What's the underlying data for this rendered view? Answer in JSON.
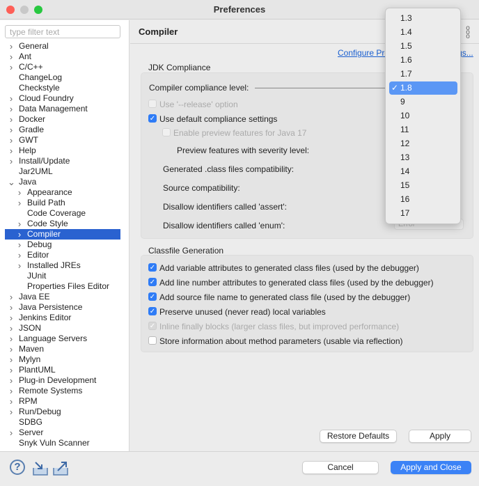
{
  "window": {
    "title": "Preferences"
  },
  "filter": {
    "placeholder": "type filter text"
  },
  "tree": [
    {
      "label": "General",
      "exp": "collapsed",
      "lvl": 0
    },
    {
      "label": "Ant",
      "exp": "collapsed",
      "lvl": 0
    },
    {
      "label": "C/C++",
      "exp": "collapsed",
      "lvl": 0
    },
    {
      "label": "ChangeLog",
      "exp": "none",
      "lvl": 0
    },
    {
      "label": "Checkstyle",
      "exp": "none",
      "lvl": 0
    },
    {
      "label": "Cloud Foundry",
      "exp": "collapsed",
      "lvl": 0
    },
    {
      "label": "Data Management",
      "exp": "collapsed",
      "lvl": 0
    },
    {
      "label": "Docker",
      "exp": "collapsed",
      "lvl": 0
    },
    {
      "label": "Gradle",
      "exp": "collapsed",
      "lvl": 0
    },
    {
      "label": "GWT",
      "exp": "collapsed",
      "lvl": 0
    },
    {
      "label": "Help",
      "exp": "collapsed",
      "lvl": 0
    },
    {
      "label": "Install/Update",
      "exp": "collapsed",
      "lvl": 0
    },
    {
      "label": "Jar2UML",
      "exp": "none",
      "lvl": 0
    },
    {
      "label": "Java",
      "exp": "expanded",
      "lvl": 0
    },
    {
      "label": "Appearance",
      "exp": "collapsed",
      "lvl": 1
    },
    {
      "label": "Build Path",
      "exp": "collapsed",
      "lvl": 1
    },
    {
      "label": "Code Coverage",
      "exp": "none",
      "lvl": 1
    },
    {
      "label": "Code Style",
      "exp": "collapsed",
      "lvl": 1
    },
    {
      "label": "Compiler",
      "exp": "collapsed",
      "lvl": 1,
      "selected": true
    },
    {
      "label": "Debug",
      "exp": "collapsed",
      "lvl": 1
    },
    {
      "label": "Editor",
      "exp": "collapsed",
      "lvl": 1
    },
    {
      "label": "Installed JREs",
      "exp": "collapsed",
      "lvl": 1
    },
    {
      "label": "JUnit",
      "exp": "none",
      "lvl": 1
    },
    {
      "label": "Properties Files Editor",
      "exp": "none",
      "lvl": 1
    },
    {
      "label": "Java EE",
      "exp": "collapsed",
      "lvl": 0
    },
    {
      "label": "Java Persistence",
      "exp": "collapsed",
      "lvl": 0
    },
    {
      "label": "Jenkins Editor",
      "exp": "collapsed",
      "lvl": 0
    },
    {
      "label": "JSON",
      "exp": "collapsed",
      "lvl": 0
    },
    {
      "label": "Language Servers",
      "exp": "collapsed",
      "lvl": 0
    },
    {
      "label": "Maven",
      "exp": "collapsed",
      "lvl": 0
    },
    {
      "label": "Mylyn",
      "exp": "collapsed",
      "lvl": 0
    },
    {
      "label": "PlantUML",
      "exp": "collapsed",
      "lvl": 0
    },
    {
      "label": "Plug-in Development",
      "exp": "collapsed",
      "lvl": 0
    },
    {
      "label": "Remote Systems",
      "exp": "collapsed",
      "lvl": 0
    },
    {
      "label": "RPM",
      "exp": "collapsed",
      "lvl": 0
    },
    {
      "label": "Run/Debug",
      "exp": "collapsed",
      "lvl": 0
    },
    {
      "label": "SDBG",
      "exp": "none",
      "lvl": 0
    },
    {
      "label": "Server",
      "exp": "collapsed",
      "lvl": 0
    },
    {
      "label": "Snyk Vuln Scanner",
      "exp": "none",
      "lvl": 0
    }
  ],
  "page": {
    "title": "Compiler",
    "configure_link": "Configure Project Specific Settings...",
    "jdk": {
      "label": "JDK Compliance",
      "compliance_level": "Compiler compliance level:",
      "use_release": {
        "label": "Use '--release' option",
        "checked": false,
        "disabled": true
      },
      "use_default": {
        "label": "Use default compliance settings",
        "checked": true
      },
      "enable_preview": {
        "label": "Enable preview features for Java 17",
        "checked": false,
        "disabled": true
      },
      "severity": "Preview features with severity level:",
      "generated": "Generated .class files compatibility:",
      "source": "Source compatibility:",
      "assert": "Disallow identifiers called 'assert':",
      "enum": "Disallow identifiers called 'enum':",
      "enum_value": "Error"
    },
    "classfile": {
      "label": "Classfile Generation",
      "options": [
        {
          "label": "Add variable attributes to generated class files (used by the debugger)",
          "checked": true
        },
        {
          "label": "Add line number attributes to generated class files (used by the debugger)",
          "checked": true
        },
        {
          "label": "Add source file name to generated class file (used by the debugger)",
          "checked": true
        },
        {
          "label": "Preserve unused (never read) local variables",
          "checked": true
        },
        {
          "label": "Inline finally blocks (larger class files, but improved performance)",
          "checked": true,
          "disabled": true
        },
        {
          "label": "Store information about method parameters (usable via reflection)",
          "checked": false
        }
      ]
    },
    "restore_defaults": "Restore Defaults",
    "apply": "Apply"
  },
  "dropdown": {
    "options": [
      "1.3",
      "1.4",
      "1.5",
      "1.6",
      "1.7",
      "1.8",
      "9",
      "10",
      "11",
      "12",
      "13",
      "14",
      "15",
      "16",
      "17"
    ],
    "selected": "1.8",
    "check": "✓"
  },
  "footer": {
    "cancel": "Cancel",
    "apply_close": "Apply and Close"
  },
  "colors": {
    "accent": "#3b82f6",
    "selection": "#2a62d0",
    "link": "#1a5fd0"
  }
}
